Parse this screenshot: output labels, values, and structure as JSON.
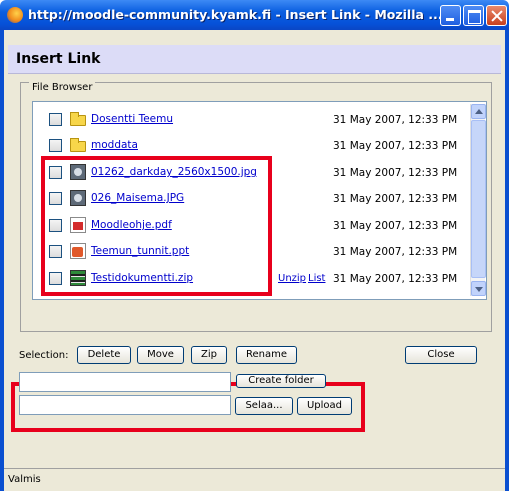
{
  "window": {
    "title": "http://moodle-community.kyamk.fi - Insert Link - Mozilla ...",
    "icon": "firefox-icon"
  },
  "dialog": {
    "title": "Insert Link"
  },
  "file_browser": {
    "legend": "File Browser",
    "files": [
      {
        "name": "Dosentti Teemu",
        "icon": "folder-icon",
        "date": "31 May 2007, 12:33 PM",
        "actions": []
      },
      {
        "name": "moddata",
        "icon": "folder-icon",
        "date": "31 May 2007, 12:33 PM",
        "actions": []
      },
      {
        "name": "01262_darkday_2560x1500.jpg",
        "icon": "image-icon",
        "date": "31 May 2007, 12:33 PM",
        "actions": []
      },
      {
        "name": "026_Maisema.JPG",
        "icon": "image-icon",
        "date": "31 May 2007, 12:33 PM",
        "actions": []
      },
      {
        "name": "Moodleohje.pdf",
        "icon": "pdf-icon",
        "date": "31 May 2007, 12:33 PM",
        "actions": []
      },
      {
        "name": "Teemun_tunnit.ppt",
        "icon": "ppt-icon",
        "date": "31 May 2007, 12:33 PM",
        "actions": []
      },
      {
        "name": "Testidokumentti.zip",
        "icon": "zip-icon",
        "date": "31 May 2007, 12:33 PM",
        "actions": [
          "Unzip",
          "List"
        ]
      }
    ]
  },
  "selection": {
    "label": "Selection:",
    "delete_label": "Delete",
    "move_label": "Move",
    "zip_label": "Zip",
    "rename_label": "Rename"
  },
  "close_label": "Close",
  "folder": {
    "input_value": "",
    "create_label": "Create folder"
  },
  "upload": {
    "input_value": "",
    "browse_label": "Selaa...",
    "upload_label": "Upload"
  },
  "status": {
    "text": "Valmis"
  },
  "accent": {
    "highlight": "#e8001c",
    "titlebar": "#0a5ee0",
    "link": "#0000cc"
  }
}
